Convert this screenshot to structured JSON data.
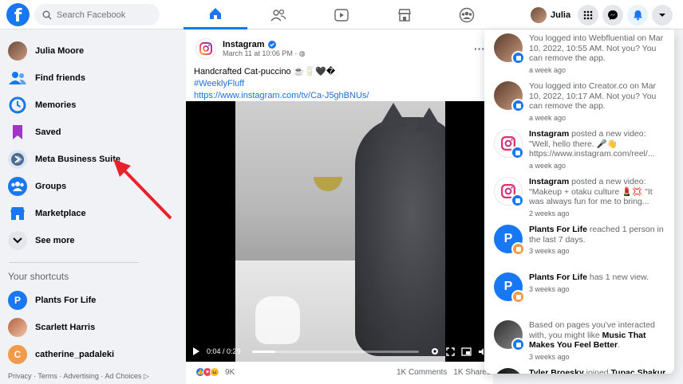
{
  "topbar": {
    "search_placeholder": "Search Facebook",
    "profile_name": "Julia",
    "nav_icons": [
      "home-icon",
      "friends-icon",
      "watch-icon",
      "marketplace-icon",
      "groups-icon"
    ]
  },
  "sidebar": {
    "items": [
      {
        "label": "Julia Moore",
        "icon": "avatar"
      },
      {
        "label": "Find friends",
        "icon": "friends-icon"
      },
      {
        "label": "Memories",
        "icon": "clock-icon"
      },
      {
        "label": "Saved",
        "icon": "bookmark-icon"
      },
      {
        "label": "Meta Business Suite",
        "icon": "business-suite-icon"
      },
      {
        "label": "Groups",
        "icon": "groups-icon"
      },
      {
        "label": "Marketplace",
        "icon": "marketplace-icon"
      },
      {
        "label": "See more",
        "icon": "chevron-down-icon"
      }
    ],
    "shortcuts_title": "Your shortcuts",
    "shortcuts": [
      {
        "label": "Plants For Life",
        "initial": "P"
      },
      {
        "label": "Scarlett Harris",
        "initial": ""
      },
      {
        "label": "catherine_padaleki",
        "initial": "C"
      }
    ],
    "footer": "Privacy · Terms · Advertising · Ad Choices ▷"
  },
  "post": {
    "author": "Instagram",
    "time": "March 11 at 10:06 PM · ",
    "line1": "Handcrafted Cat-puccino ☕🥛🖤�",
    "hashtag": "#WeeklyFluff",
    "link": "https://www.instagram.com/tv/Ca-J5ghBNUs/",
    "video_time": "0:04 / 0:29",
    "progress": 0.14,
    "reaction_count": "9K",
    "comments": "1K Comments",
    "shares": "1K Shares"
  },
  "notifications": [
    {
      "text_pre": "You logged into Webfluential on Mar 10, 2022, 10:55 AM. Not you? You can remove the app.",
      "bold": "",
      "text_post": "",
      "time": "a week ago",
      "avatar": "julia",
      "badge": "shield"
    },
    {
      "text_pre": "You logged into Creator.co on Mar 10, 2022, 10:17 AM. Not you? You can remove the app.",
      "bold": "",
      "text_post": "",
      "time": "a week ago",
      "avatar": "julia",
      "badge": "shield"
    },
    {
      "text_pre": "",
      "bold": "Instagram",
      "text_post": " posted a new video: \"Well, hello there. 🎤👋 https://www.instagram.com/reel/...",
      "time": "a week ago",
      "avatar": "instagram",
      "badge": "video"
    },
    {
      "text_pre": "",
      "bold": "Instagram",
      "text_post": " posted a new video: \"Makeup + otaku culture 💄💢 \"It was always fun for me to bring...",
      "time": "2 weeks ago",
      "avatar": "instagram",
      "badge": "video"
    },
    {
      "text_pre": "",
      "bold": "Plants For Life",
      "text_post": " reached 1 person in the last 7 days.",
      "time": "3 weeks ago",
      "avatar": "P",
      "badge": "flag"
    },
    {
      "text_pre": "",
      "bold": "Plants For Life",
      "text_post": " has 1 new view.",
      "time": "3 weeks ago",
      "avatar": "P",
      "badge": "flag"
    },
    {
      "text_pre": "Based on pages you've interacted with, you might like ",
      "bold": "Music That Makes You Feel Better",
      "text_post": ".",
      "time": "3 weeks ago",
      "avatar": "music",
      "badge": "groups"
    },
    {
      "text_pre": "",
      "bold": "Tyler Broesky",
      "text_post": " joined ",
      "bold2": "Tupac Shakur Quotes",
      "time": "",
      "avatar": "tyler",
      "badge": "groups"
    }
  ],
  "colors": {
    "brand": "#1877f2",
    "arrow": "#e8222a"
  }
}
